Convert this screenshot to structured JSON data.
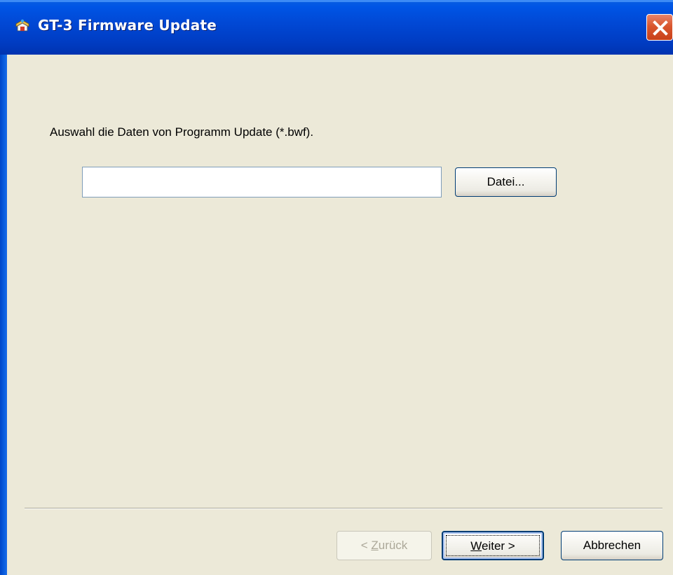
{
  "window": {
    "title": "GT-3 Firmware Update",
    "app_icon": "firmware-app-icon",
    "close_icon": "close-icon",
    "accent_color": "#0055E5",
    "close_color": "#D9562E"
  },
  "content": {
    "instruction": "Auswahl die Daten von Programm Update (*.bwf).",
    "file_path_value": "",
    "file_button_label": "Datei..."
  },
  "footer": {
    "back_mnemonic": "Z",
    "back_rest": "urück",
    "next_mnemonic": "W",
    "next_rest": "eiter >",
    "cancel_label": "Abbrechen"
  }
}
